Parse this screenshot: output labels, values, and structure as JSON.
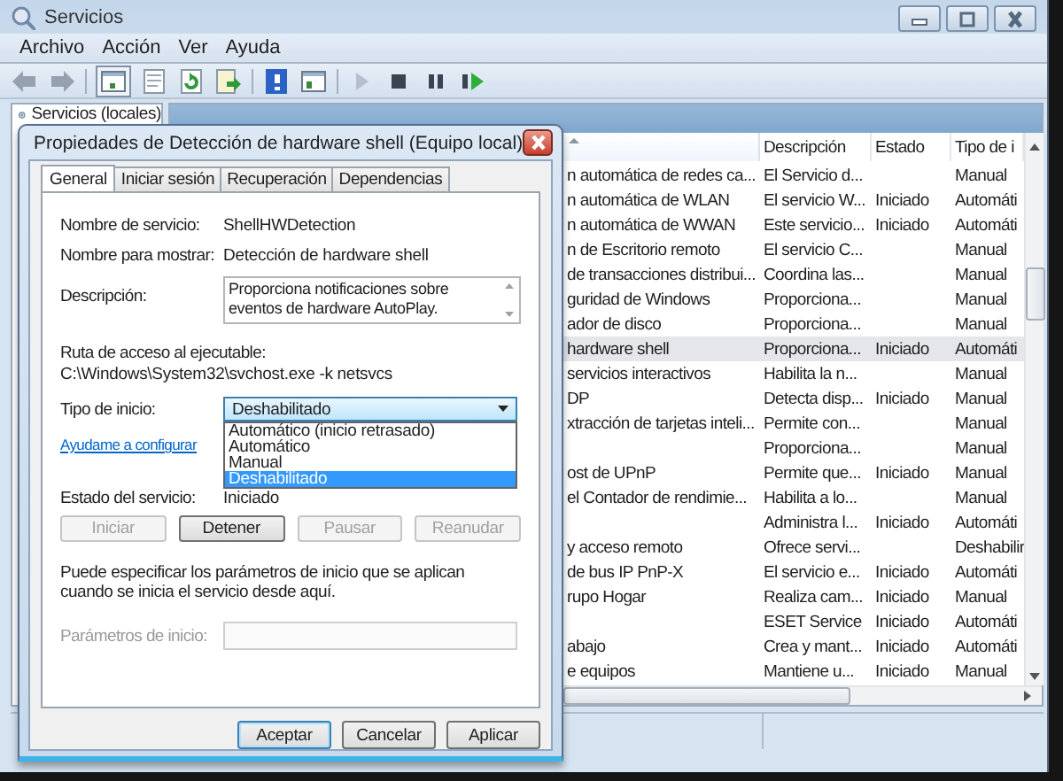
{
  "window": {
    "title": "Servicios"
  },
  "menu": [
    "Archivo",
    "Acción",
    "Ver",
    "Ayuda"
  ],
  "toolbar": {
    "groups": [
      [
        {
          "kind": "back",
          "disabled": true,
          "pressed": false
        },
        {
          "kind": "forward",
          "disabled": true,
          "pressed": false
        }
      ],
      [
        {
          "kind": "tree",
          "disabled": false,
          "pressed": true
        },
        {
          "kind": "properties",
          "disabled": false,
          "pressed": false
        },
        {
          "kind": "refresh",
          "disabled": false,
          "pressed": false
        },
        {
          "kind": "export",
          "disabled": false,
          "pressed": false
        }
      ],
      [
        {
          "kind": "help",
          "disabled": false,
          "pressed": false
        },
        {
          "kind": "view",
          "disabled": false,
          "pressed": false
        }
      ],
      [
        {
          "kind": "play",
          "disabled": true,
          "pressed": false
        },
        {
          "kind": "stop",
          "disabled": false,
          "pressed": false
        },
        {
          "kind": "pause",
          "disabled": false,
          "pressed": false
        },
        {
          "kind": "resume",
          "disabled": false,
          "pressed": false
        }
      ]
    ]
  },
  "tree": {
    "items": [
      {
        "label": "Servicios (locales)"
      }
    ]
  },
  "services": {
    "columns": [
      {
        "sorted": true
      },
      {
        "label": "Descripción",
        "sorted": false
      },
      {
        "label": "Estado",
        "sorted": false
      },
      {
        "label": "Tipo de i",
        "sorted": false
      }
    ],
    "rows": [
      {
        "name": "n automática de redes ca...",
        "description": "El Servicio d...",
        "startup": "Manual",
        "selected": false
      },
      {
        "name": "n automática de WLAN",
        "description": "El servicio W...",
        "status": "Iniciado",
        "startup": "Automáti",
        "selected": false
      },
      {
        "name": "n automática de WWAN",
        "description": "Este servicio...",
        "status": "Iniciado",
        "startup": "Automáti",
        "selected": false
      },
      {
        "name": "n de Escritorio remoto",
        "description": "El servicio C...",
        "startup": "Manual",
        "selected": false
      },
      {
        "name": "de transacciones distribui...",
        "description": "Coordina las...",
        "startup": "Manual",
        "selected": false
      },
      {
        "name": "guridad de Windows",
        "description": "Proporciona...",
        "startup": "Manual",
        "selected": false
      },
      {
        "name": "ador de disco",
        "description": "Proporciona...",
        "startup": "Manual",
        "selected": false
      },
      {
        "name": "hardware shell",
        "description": "Proporciona...",
        "status": "Iniciado",
        "startup": "Automáti",
        "selected": true
      },
      {
        "name": "servicios interactivos",
        "description": "Habilita la n...",
        "startup": "Manual",
        "selected": false
      },
      {
        "name": "DP",
        "description": "Detecta disp...",
        "status": "Iniciado",
        "startup": "Manual",
        "selected": false
      },
      {
        "name": "xtracción de tarjetas inteli...",
        "description": "Permite con...",
        "startup": "Manual",
        "selected": false
      },
      {
        "description": "Proporciona...",
        "startup": "Manual",
        "selected": false
      },
      {
        "name": "ost de UPnP",
        "description": "Permite que...",
        "status": "Iniciado",
        "startup": "Manual",
        "selected": false
      },
      {
        "name": "el Contador de rendimie...",
        "description": "Habilita a lo...",
        "startup": "Manual",
        "selected": false
      },
      {
        "description": "Administra l...",
        "status": "Iniciado",
        "startup": "Automáti",
        "selected": false
      },
      {
        "name": "y acceso remoto",
        "description": "Ofrece servi...",
        "startup": "Deshabilir",
        "selected": false
      },
      {
        "name": "de bus IP PnP-X",
        "description": "El servicio e...",
        "status": "Iniciado",
        "startup": "Automáti",
        "selected": false
      },
      {
        "name": "rupo Hogar",
        "description": "Realiza cam...",
        "status": "Iniciado",
        "startup": "Manual",
        "selected": false
      },
      {
        "description": "ESET Service",
        "status": "Iniciado",
        "startup": "Automáti",
        "selected": false
      },
      {
        "name": "abajo",
        "description": "Crea y mant...",
        "status": "Iniciado",
        "startup": "Automáti",
        "selected": false
      },
      {
        "name": "e equipos",
        "description": "Mantiene u...",
        "status": "Iniciado",
        "startup": "Manual",
        "selected": false
      }
    ]
  },
  "dialog": {
    "title": "Propiedades de Detección de hardware shell (Equipo local)",
    "tabs": [
      {
        "label": "General",
        "selected": true
      },
      {
        "label": "Iniciar sesión",
        "selected": false
      },
      {
        "label": "Recuperación",
        "selected": false
      },
      {
        "label": "Dependencias",
        "selected": false
      }
    ],
    "service_name": {
      "label": "Nombre de servicio:",
      "value": "ShellHWDetection"
    },
    "display_name": {
      "label": "Nombre para mostrar:",
      "value": "Detección de hardware shell"
    },
    "description": {
      "label": "Descripción:",
      "value": "Proporciona notificaciones sobre eventos de hardware AutoPlay."
    },
    "executable_path": {
      "label": "Ruta de acceso al ejecutable:",
      "value": "C:\\Windows\\System32\\svchost.exe -k netsvcs"
    },
    "startup_type": {
      "label": "Tipo de inicio:",
      "value": "Deshabilitado",
      "expanded": true,
      "options": [
        {
          "label": "Automático (inicio retrasado)",
          "selected": false
        },
        {
          "label": "Automático",
          "selected": false
        },
        {
          "label": "Manual",
          "selected": false
        },
        {
          "label": "Deshabilitado",
          "selected": true
        }
      ]
    },
    "help_link": "Ayudame a configurar",
    "service_status": {
      "label": "Estado del servicio:",
      "value": "Iniciado"
    },
    "service_buttons": [
      {
        "label": "Iniciar",
        "disabled": true
      },
      {
        "label": "Detener",
        "disabled": false
      },
      {
        "label": "Pausar",
        "disabled": true
      },
      {
        "label": "Reanudar",
        "disabled": true
      }
    ],
    "note": "Puede especificar los parámetros de inicio que se aplican cuando se inicia el servicio desde aquí.",
    "start_parameters": {
      "label": "Parámetros de inicio:",
      "disabled": true
    },
    "buttons": [
      {
        "label": "Aceptar",
        "default": true
      },
      {
        "label": "Cancelar",
        "default": false
      },
      {
        "label": "Aplicar",
        "default": false
      }
    ]
  }
}
